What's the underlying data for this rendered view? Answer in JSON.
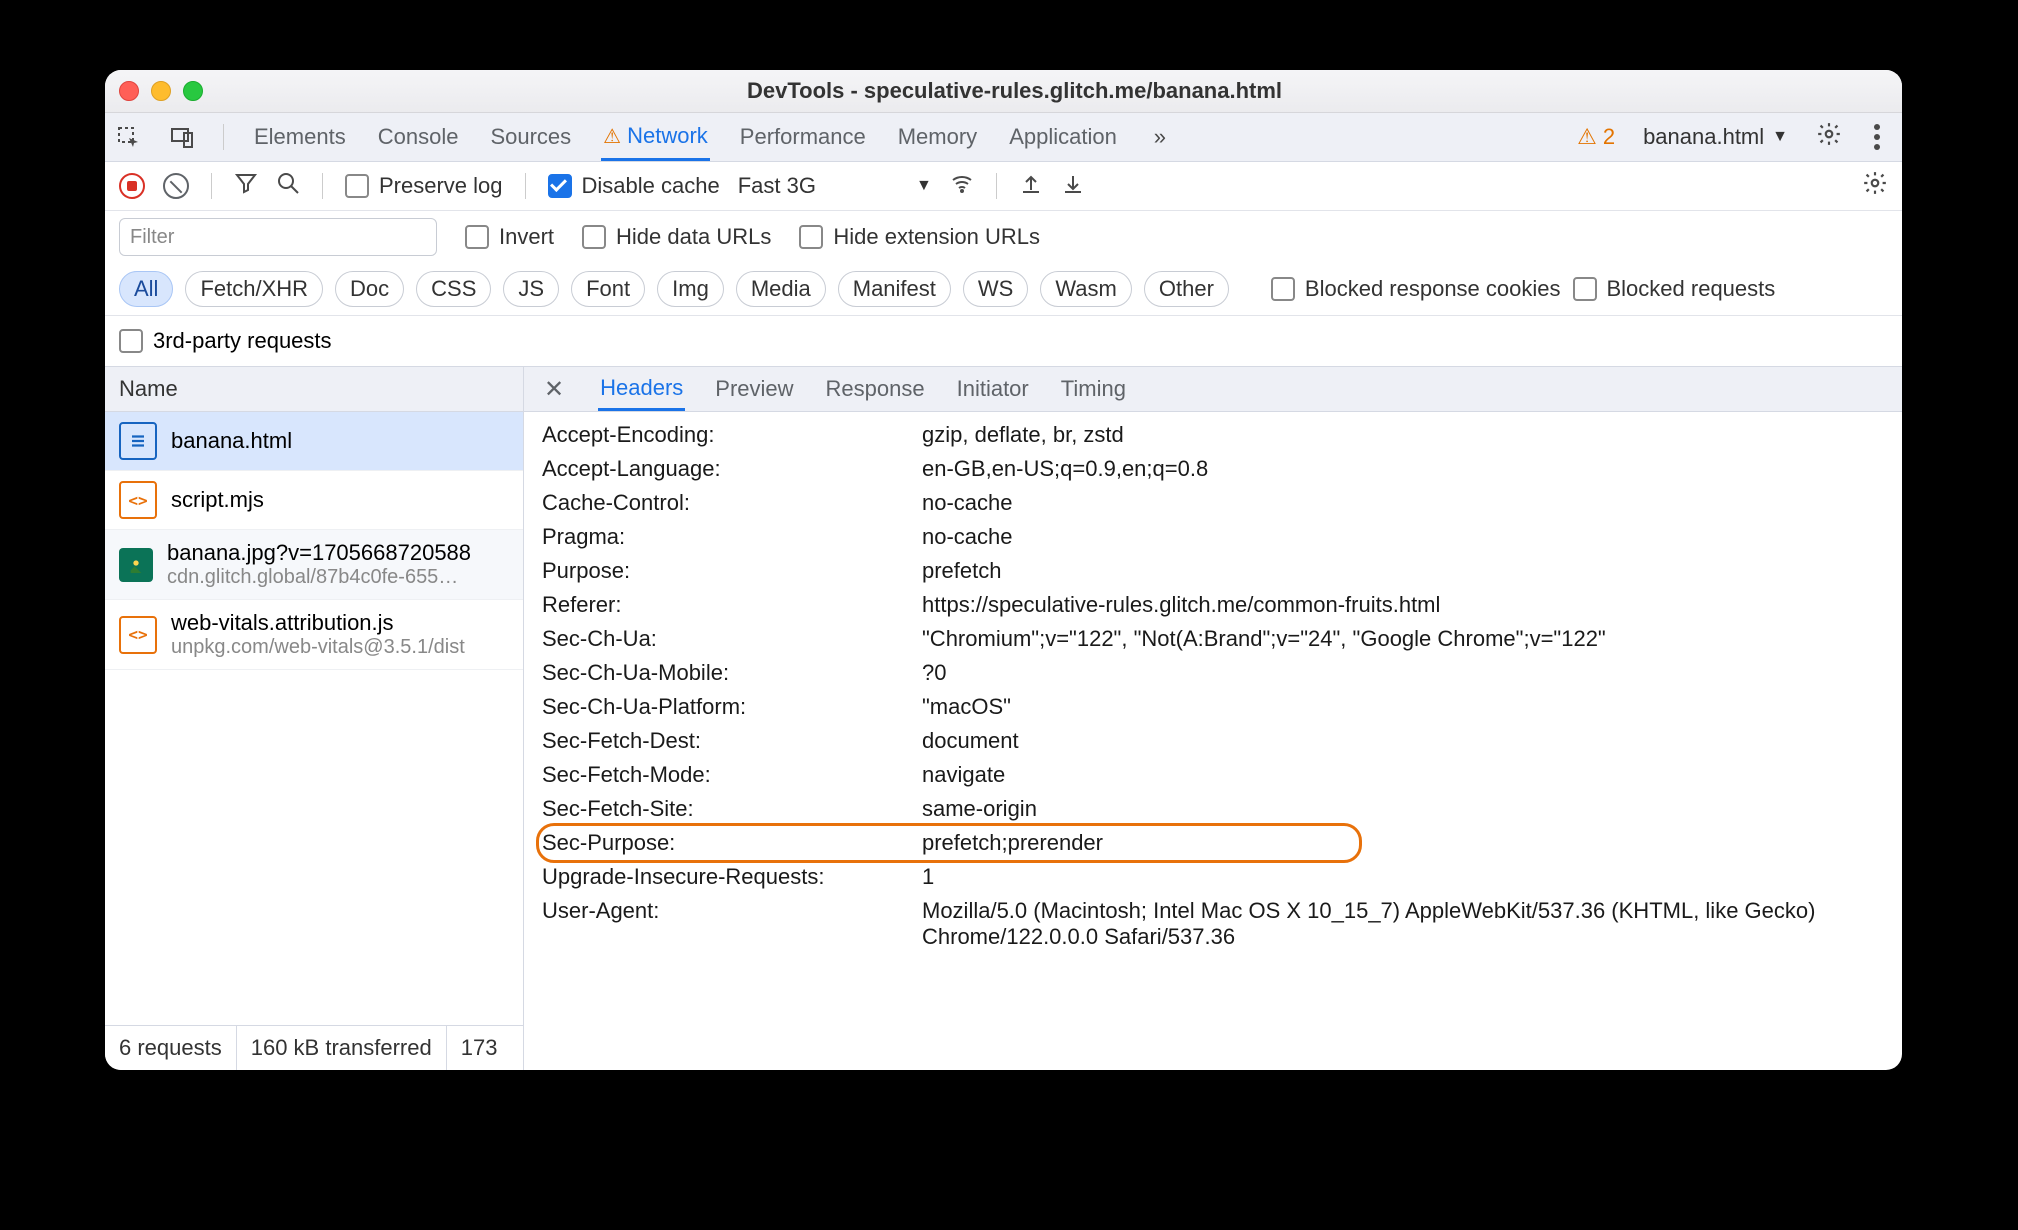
{
  "window_title": "DevTools - speculative-rules.glitch.me/banana.html",
  "issues_count": "2",
  "context_file": "banana.html",
  "main_tabs": {
    "elements": "Elements",
    "console": "Console",
    "sources": "Sources",
    "network": "Network",
    "performance": "Performance",
    "memory": "Memory",
    "application": "Application"
  },
  "toolbar": {
    "preserve_log": "Preserve log",
    "disable_cache": "Disable cache",
    "throttle": "Fast 3G"
  },
  "filter": {
    "placeholder": "Filter",
    "invert": "Invert",
    "hide_data": "Hide data URLs",
    "hide_ext": "Hide extension URLs",
    "chips": {
      "all": "All",
      "fetch": "Fetch/XHR",
      "doc": "Doc",
      "css": "CSS",
      "js": "JS",
      "font": "Font",
      "img": "Img",
      "media": "Media",
      "manifest": "Manifest",
      "ws": "WS",
      "wasm": "Wasm",
      "other": "Other"
    },
    "blocked_cookies": "Blocked response cookies",
    "blocked_requests": "Blocked requests",
    "third_party": "3rd-party requests"
  },
  "request_list": {
    "header": "Name",
    "items": [
      {
        "name": "banana.html",
        "sub": ""
      },
      {
        "name": "script.mjs",
        "sub": ""
      },
      {
        "name": "banana.jpg?v=1705668720588",
        "sub": "cdn.glitch.global/87b4c0fe-655…"
      },
      {
        "name": "web-vitals.attribution.js",
        "sub": "unpkg.com/web-vitals@3.5.1/dist"
      }
    ]
  },
  "status": {
    "requests": "6 requests",
    "transferred": "160 kB transferred",
    "resources": "173"
  },
  "detail_tabs": {
    "headers": "Headers",
    "preview": "Preview",
    "response": "Response",
    "initiator": "Initiator",
    "timing": "Timing"
  },
  "headers": [
    {
      "name": "Accept-Encoding:",
      "value": "gzip, deflate, br, zstd"
    },
    {
      "name": "Accept-Language:",
      "value": "en-GB,en-US;q=0.9,en;q=0.8"
    },
    {
      "name": "Cache-Control:",
      "value": "no-cache"
    },
    {
      "name": "Pragma:",
      "value": "no-cache"
    },
    {
      "name": "Purpose:",
      "value": "prefetch"
    },
    {
      "name": "Referer:",
      "value": "https://speculative-rules.glitch.me/common-fruits.html"
    },
    {
      "name": "Sec-Ch-Ua:",
      "value": "\"Chromium\";v=\"122\", \"Not(A:Brand\";v=\"24\", \"Google Chrome\";v=\"122\""
    },
    {
      "name": "Sec-Ch-Ua-Mobile:",
      "value": "?0"
    },
    {
      "name": "Sec-Ch-Ua-Platform:",
      "value": "\"macOS\""
    },
    {
      "name": "Sec-Fetch-Dest:",
      "value": "document"
    },
    {
      "name": "Sec-Fetch-Mode:",
      "value": "navigate"
    },
    {
      "name": "Sec-Fetch-Site:",
      "value": "same-origin"
    },
    {
      "name": "Sec-Purpose:",
      "value": "prefetch;prerender",
      "highlight": true
    },
    {
      "name": "Upgrade-Insecure-Requests:",
      "value": "1"
    },
    {
      "name": "User-Agent:",
      "value": "Mozilla/5.0 (Macintosh; Intel Mac OS X 10_15_7) AppleWebKit/537.36 (KHTML, like Gecko) Chrome/122.0.0.0 Safari/537.36"
    }
  ]
}
